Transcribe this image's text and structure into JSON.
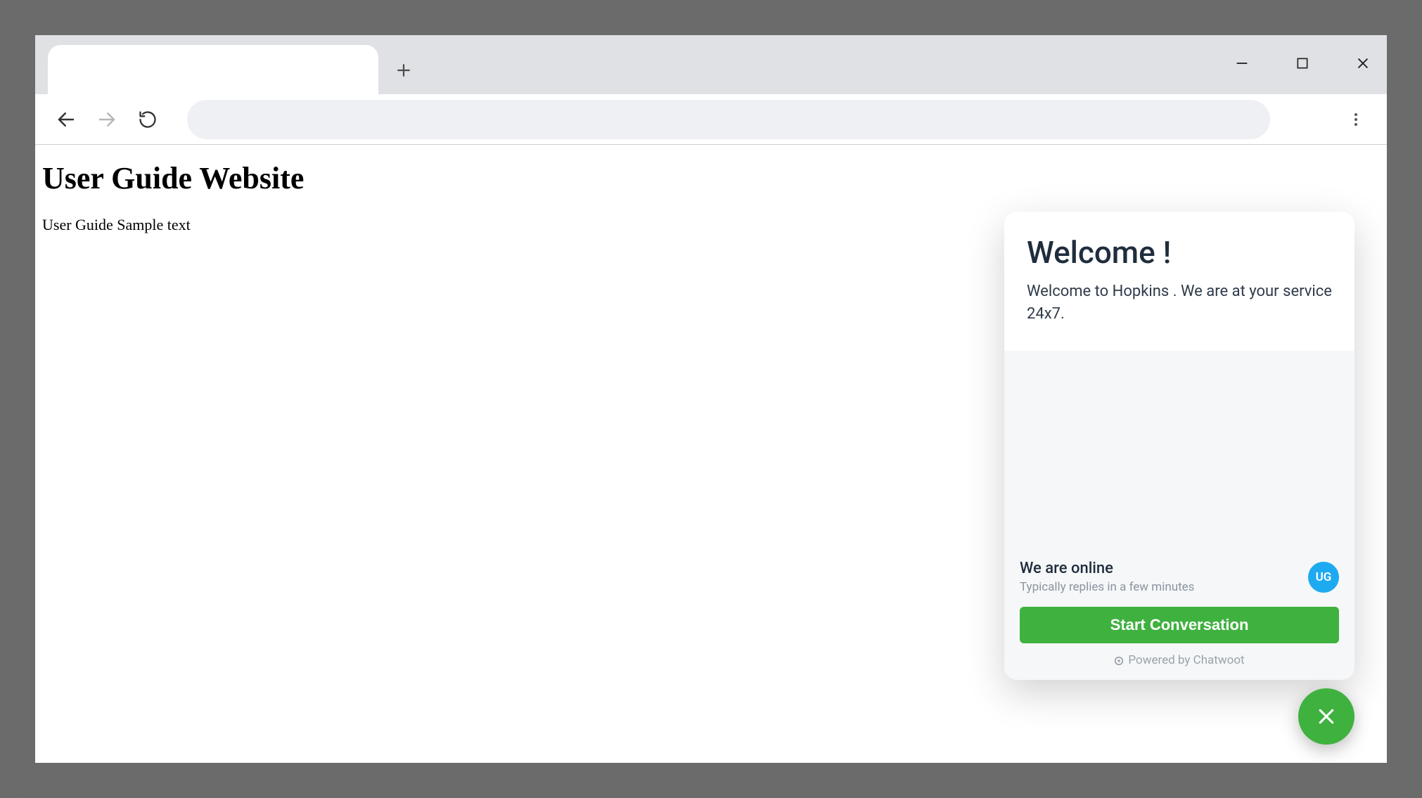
{
  "page": {
    "title": "User Guide Website",
    "body_text": "User Guide Sample text"
  },
  "chat": {
    "header_title": "Welcome !",
    "header_text": "Welcome to Hopkins . We are at your service 24x7.",
    "online_title": "We are online",
    "online_subtext": "Typically replies in a few minutes",
    "avatar_initials": "UG",
    "start_button": "Start Conversation",
    "powered_by": "Powered by Chatwoot"
  }
}
